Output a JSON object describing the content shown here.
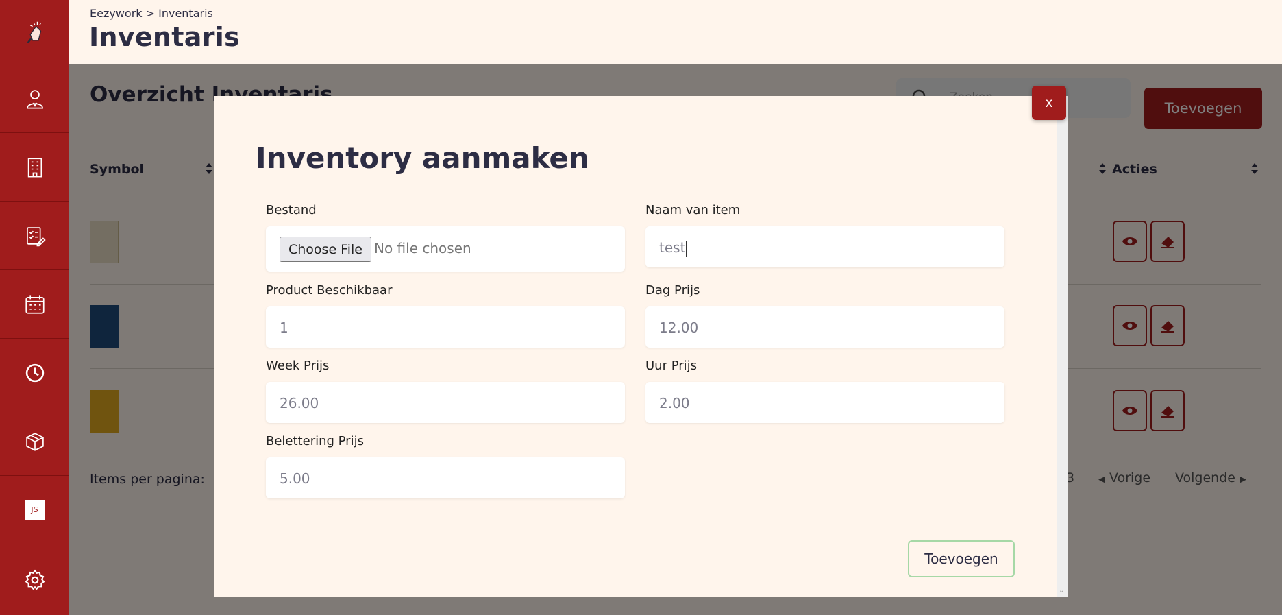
{
  "breadcrumb": "Eezywork > Inventaris",
  "page_title": "Inventaris",
  "main": {
    "section_title": "Overzicht Inventaris",
    "search_placeholder": "Zoeken",
    "add_button": "Toevoegen",
    "columns": {
      "symbol": "Symbol",
      "actions": "Acties"
    },
    "items_per_page": "Items per pagina:",
    "page_number": "3",
    "prev": "Vorige",
    "next": "Volgende"
  },
  "sidebar": {
    "avatar_initials": "JS",
    "icons": [
      "logo-icon",
      "user-icon",
      "building-icon",
      "checklist-icon",
      "calendar-icon",
      "clock-icon",
      "package-icon",
      "settings-icon"
    ]
  },
  "modal": {
    "title": "Inventory aanmaken",
    "close_label": "x",
    "file_label": "Bestand",
    "file_button": "Choose File",
    "file_status": "No file chosen",
    "name_label": "Naam van item",
    "name_value": "test",
    "available_label": "Product Beschikbaar",
    "available_placeholder": "1",
    "day_label": "Dag Prijs",
    "day_placeholder": "12.00",
    "week_label": "Week Prijs",
    "week_placeholder": "26.00",
    "hour_label": "Uur Prijs",
    "hour_placeholder": "2.00",
    "lettering_label": "Belettering Prijs",
    "lettering_placeholder": "5.00",
    "submit_label": "Toevoegen"
  },
  "colors": {
    "brand": "#a01c1c",
    "background": "#fff5ec",
    "text": "#2d2d44",
    "submit_border": "#a6d8a6"
  }
}
